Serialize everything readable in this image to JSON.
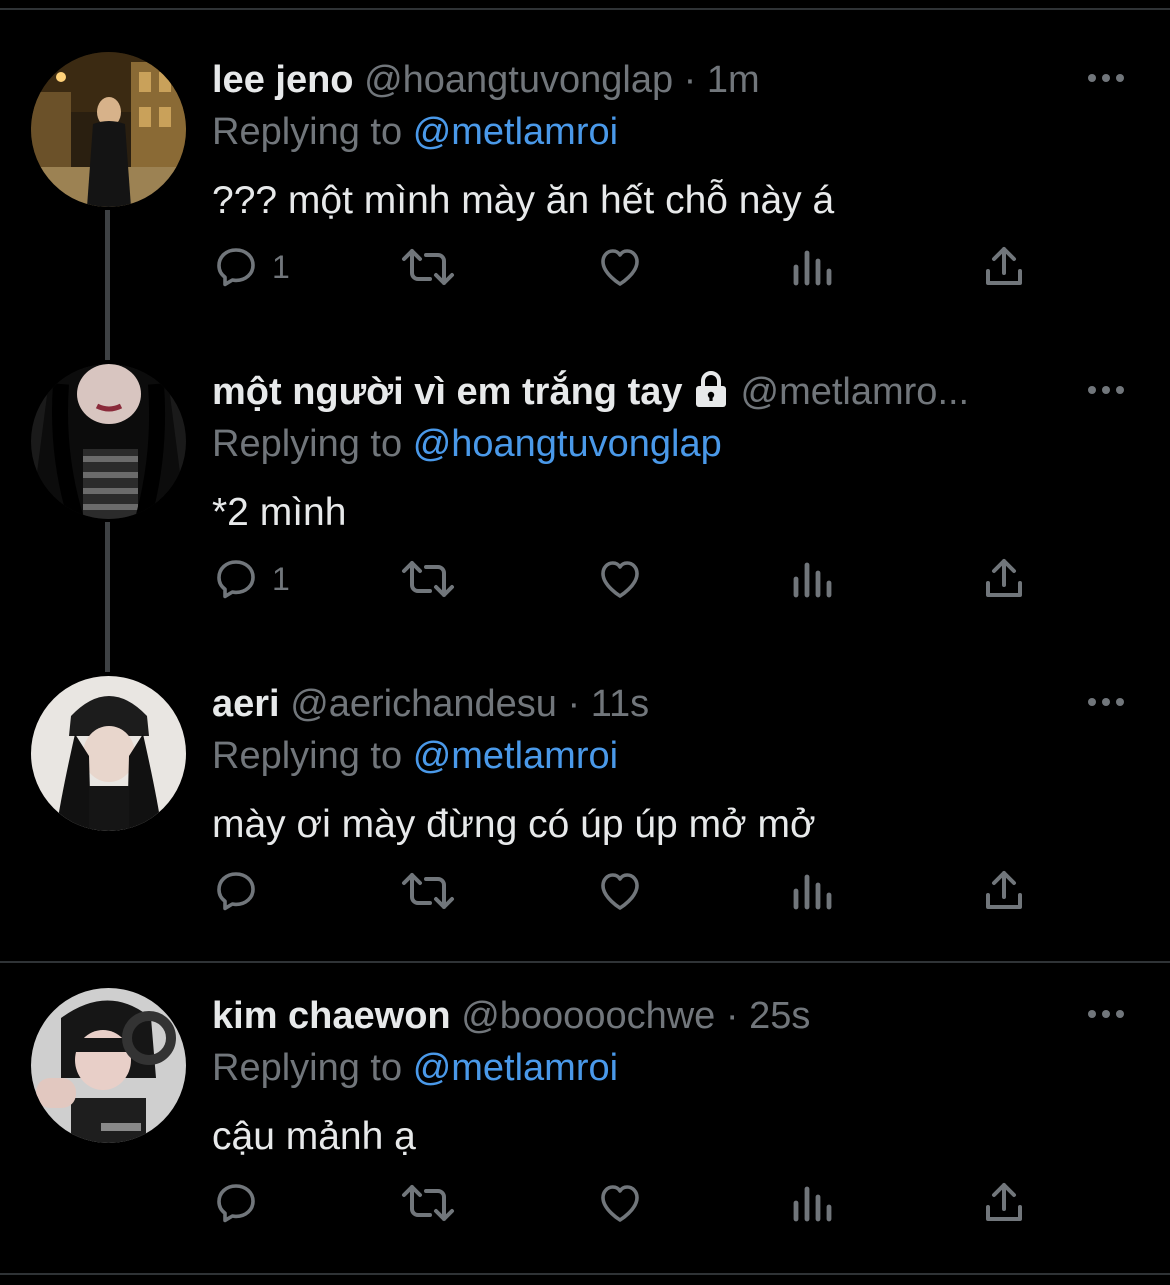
{
  "tweets": [
    {
      "name": "lee jeno",
      "handle": "@hoangtuvonglap",
      "time": "1m",
      "reply_prefix": "Replying to",
      "reply_to": "@metlamroi",
      "text": "??? một mình mày ăn hết chỗ này á",
      "reply_count": "1",
      "protected": false
    },
    {
      "name": "một người vì em trắng tay",
      "handle": "@metlamro...",
      "time": "",
      "reply_prefix": "Replying to",
      "reply_to": "@hoangtuvonglap",
      "text": "*2 mình",
      "reply_count": "1",
      "protected": true
    },
    {
      "name": "aeri",
      "handle": "@aerichandesu",
      "time": "11s",
      "reply_prefix": "Replying to",
      "reply_to": "@metlamroi",
      "text": "mày ơi mày đừng có úp úp mở mở",
      "reply_count": "",
      "protected": false
    },
    {
      "name": "kim chaewon",
      "handle": "@booooochwe",
      "time": "25s",
      "reply_prefix": "Replying to",
      "reply_to": "@metlamroi",
      "text": "cậu mảnh ạ",
      "reply_count": "",
      "protected": false
    }
  ],
  "icons": {
    "reply": "reply-icon",
    "retweet": "retweet-icon",
    "like": "heart-icon",
    "views": "views-icon",
    "share": "share-icon",
    "more": "more-icon",
    "lock": "lock-icon"
  },
  "colors": {
    "background": "#000000",
    "text": "#e7e9ea",
    "muted": "#71767b",
    "link": "#4a99e9",
    "divider": "#2f3336"
  }
}
